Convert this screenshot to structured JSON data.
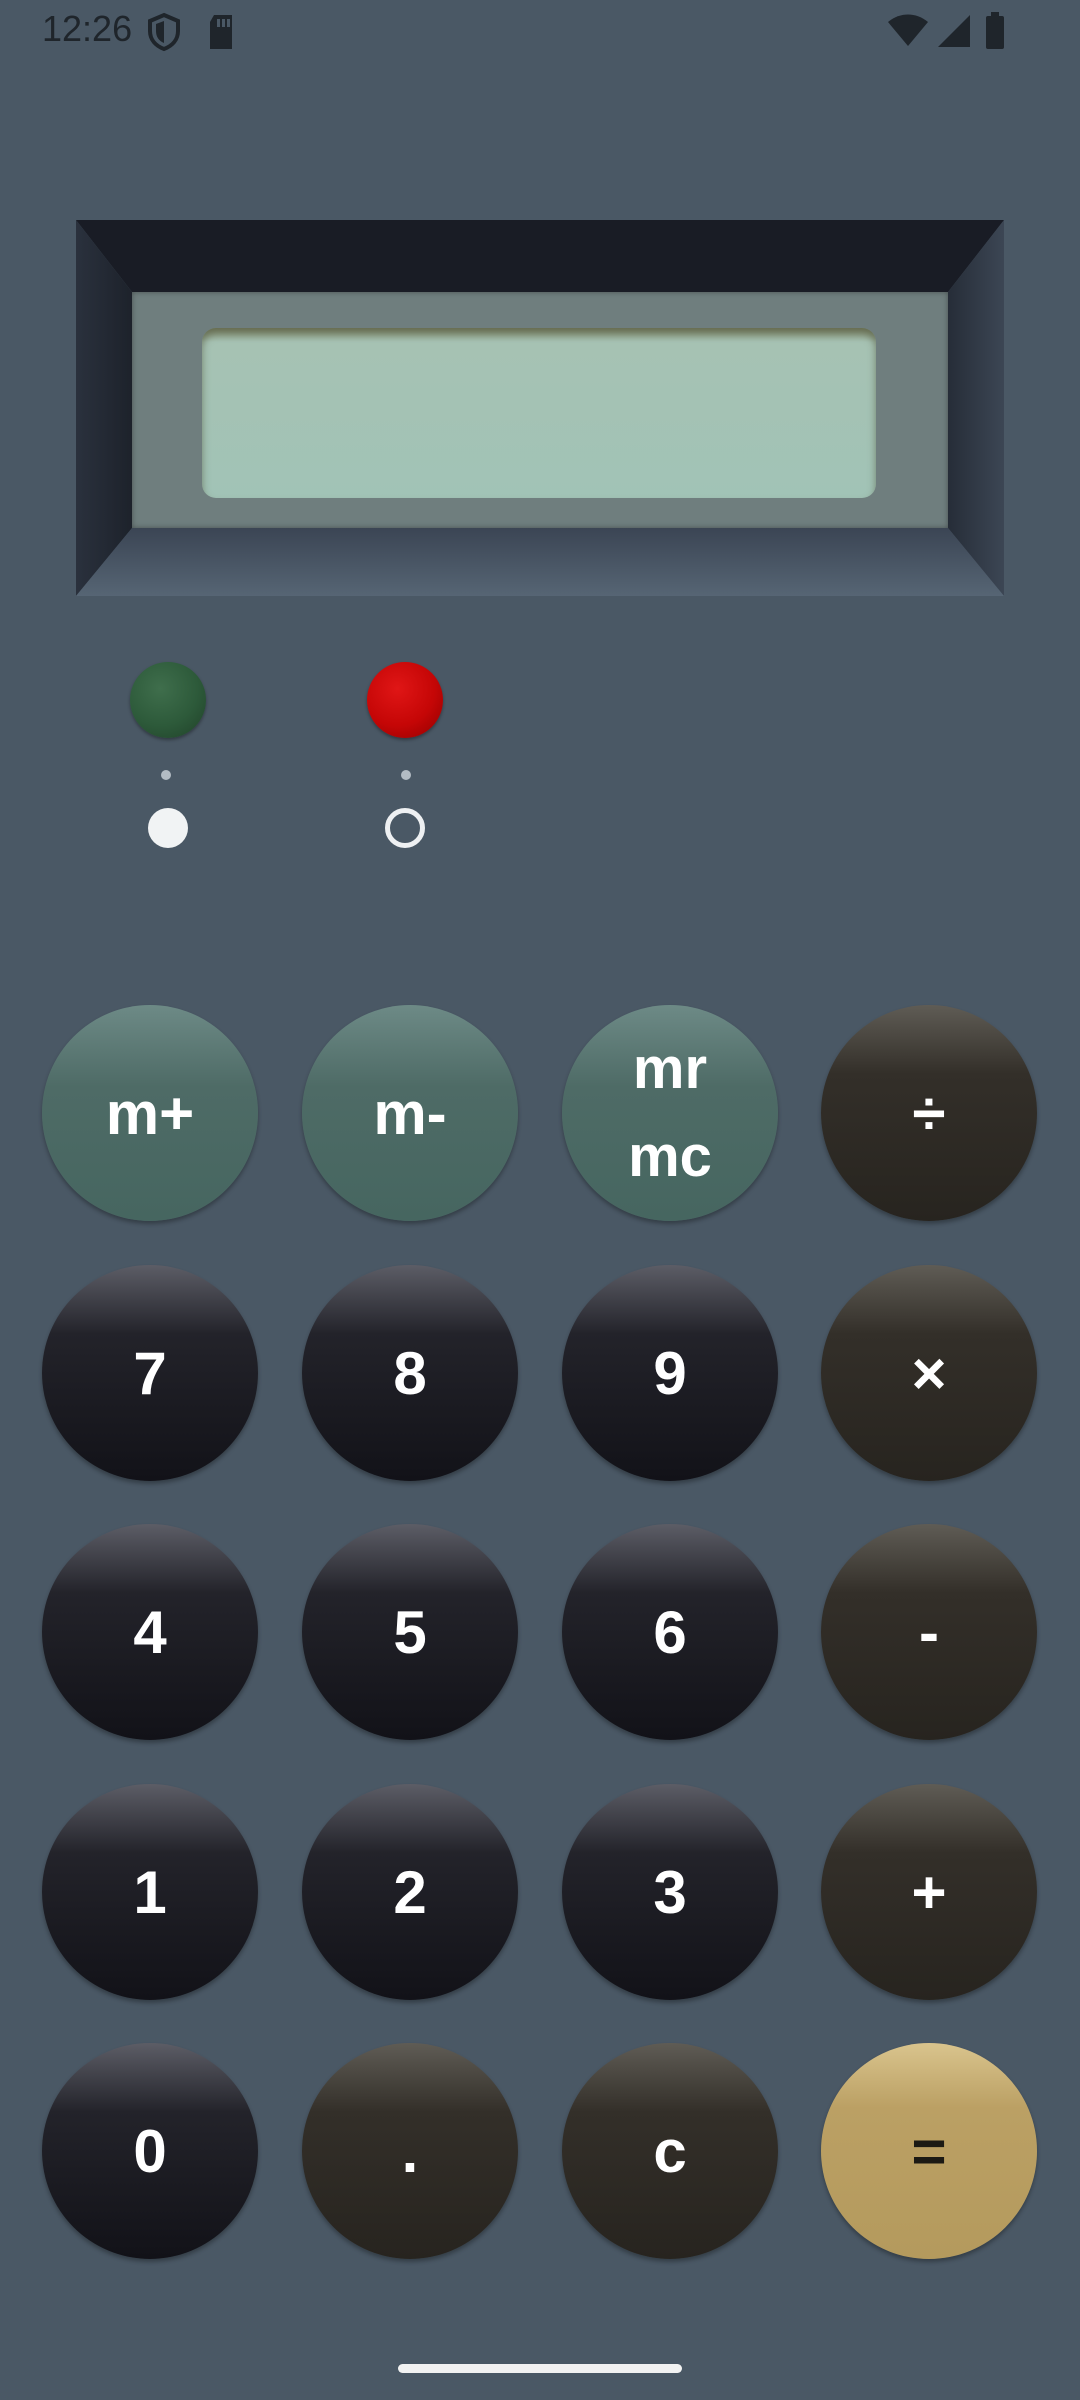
{
  "status_bar": {
    "time": "12:26",
    "icons_left": [
      "shield-icon",
      "sd-card-icon"
    ],
    "icons_right": [
      "wifi-icon",
      "signal-icon",
      "battery-icon"
    ]
  },
  "display": {
    "value": "",
    "indicators": [
      {
        "name": "green-indicator",
        "color": "#2d5a3a",
        "selected": true
      },
      {
        "name": "red-indicator",
        "color": "#c50606",
        "selected": false
      }
    ]
  },
  "keypad": {
    "m_plus": "m+",
    "m_minus": "m-",
    "mr": "mr",
    "mc": "mc",
    "divide": "÷",
    "seven": "7",
    "eight": "8",
    "nine": "9",
    "multiply": "×",
    "four": "4",
    "five": "5",
    "six": "6",
    "subtract": "-",
    "one": "1",
    "two": "2",
    "three": "3",
    "add": "+",
    "zero": "0",
    "decimal": ".",
    "clear": "c",
    "equals": "="
  },
  "colors": {
    "background": "#4a5865",
    "memory_key": "#4e6b66",
    "number_key": "#121218",
    "operator_key": "#27241f",
    "equals_key": "#b49a5d",
    "lcd": "#a1c3b6"
  }
}
